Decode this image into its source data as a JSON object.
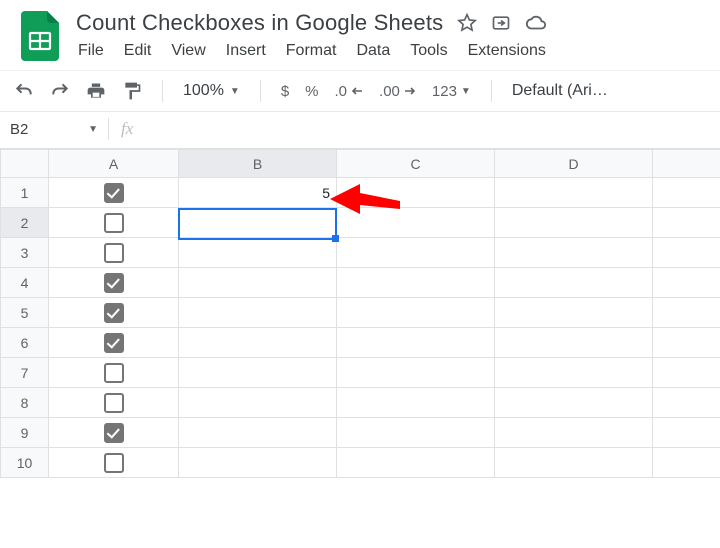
{
  "doc": {
    "title": "Count Checkboxes in Google Sheets"
  },
  "menu": {
    "file": "File",
    "edit": "Edit",
    "view": "View",
    "insert": "Insert",
    "format": "Format",
    "data": "Data",
    "tools": "Tools",
    "extensions": "Extensions"
  },
  "toolbar": {
    "zoom": "100%",
    "currency": "$",
    "percent": "%",
    "dec_dec": ".0",
    "inc_dec": ".00",
    "numfmt": "123",
    "font": "Default (Ari…"
  },
  "namebox": {
    "cell": "B2",
    "fx_label": "fx"
  },
  "columns": [
    "A",
    "B",
    "C",
    "D"
  ],
  "rows": [
    "1",
    "2",
    "3",
    "4",
    "5",
    "6",
    "7",
    "8",
    "9",
    "10"
  ],
  "cells": {
    "A1": {
      "checkbox": true,
      "checked": true
    },
    "A2": {
      "checkbox": true,
      "checked": false
    },
    "A3": {
      "checkbox": true,
      "checked": false
    },
    "A4": {
      "checkbox": true,
      "checked": true
    },
    "A5": {
      "checkbox": true,
      "checked": true
    },
    "A6": {
      "checkbox": true,
      "checked": true
    },
    "A7": {
      "checkbox": true,
      "checked": false
    },
    "A8": {
      "checkbox": true,
      "checked": false
    },
    "A9": {
      "checkbox": true,
      "checked": true
    },
    "A10": {
      "checkbox": true,
      "checked": false
    },
    "B1": {
      "value": "5"
    }
  },
  "selection": {
    "col": "B",
    "row": "2"
  }
}
